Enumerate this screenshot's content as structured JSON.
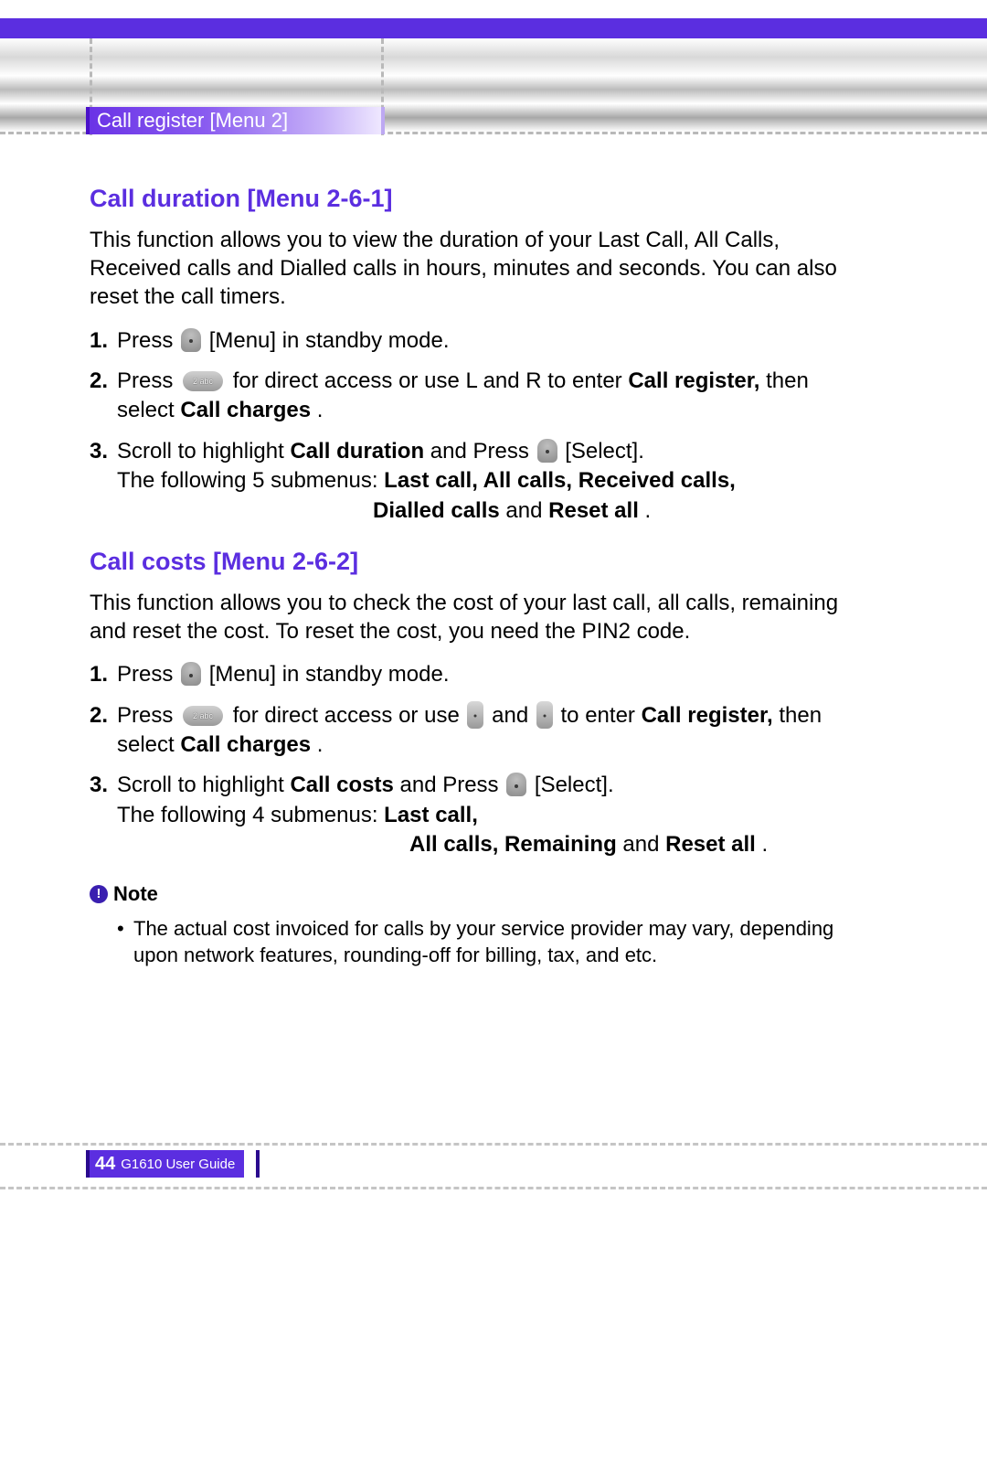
{
  "header": {
    "tab": "Call register [Menu 2]"
  },
  "section1": {
    "title": "Call duration [Menu 2-6-1]",
    "intro": "This function allows you to view the duration of your Last Call, All Calls, Received calls and Dialled calls in hours, minutes and seconds. You can also reset the call timers.",
    "steps": {
      "n1": "1.",
      "s1a": "Press ",
      "s1b": " [Menu] in standby mode.",
      "n2": "2.",
      "s2a": "Press ",
      "s2b": " for direct access or use L and R to enter ",
      "s2c": "Call register,",
      "s2d": " then select ",
      "s2e": "Call charges",
      "s2f": ".",
      "n3": "3.",
      "s3a": "Scroll to highlight ",
      "s3b": "Call duration",
      "s3c": " and Press ",
      "s3d": " [Select].",
      "s3e": "The following 5 submenus: ",
      "s3f": "Last call, All calls, Received calls,",
      "s3g": "Dialled calls",
      "s3h": " and ",
      "s3i": "Reset all",
      "s3j": "."
    }
  },
  "section2": {
    "title": "Call costs [Menu 2-6-2]",
    "intro": "This function allows you to check the cost of your last call, all calls, remaining and reset the cost. To reset the cost, you need the PIN2 code.",
    "steps": {
      "n1": "1.",
      "s1a": "Press ",
      "s1b": " [Menu] in standby mode.",
      "n2": "2.",
      "s2a": "Press ",
      "s2b": " for direct access or use ",
      "s2c": " and ",
      "s2d": " to enter ",
      "s2e": "Call register,",
      "s2f": " then select ",
      "s2g": "Call charges",
      "s2h": ".",
      "n3": "3.",
      "s3a": "Scroll to highlight ",
      "s3b": "Call costs",
      "s3c": " and Press ",
      "s3d": " [Select].",
      "s3e": "The following 4 submenus: ",
      "s3f": "Last call,",
      "s3g": "All calls, Remaining",
      "s3h": " and ",
      "s3i": "Reset all",
      "s3j": "."
    }
  },
  "note": {
    "title": "Note",
    "item": "The actual cost invoiced for calls by your service provider may vary, depending upon network features, rounding-off for billing, tax, and etc."
  },
  "footer": {
    "page": "44",
    "guide": "G1610 User Guide"
  }
}
